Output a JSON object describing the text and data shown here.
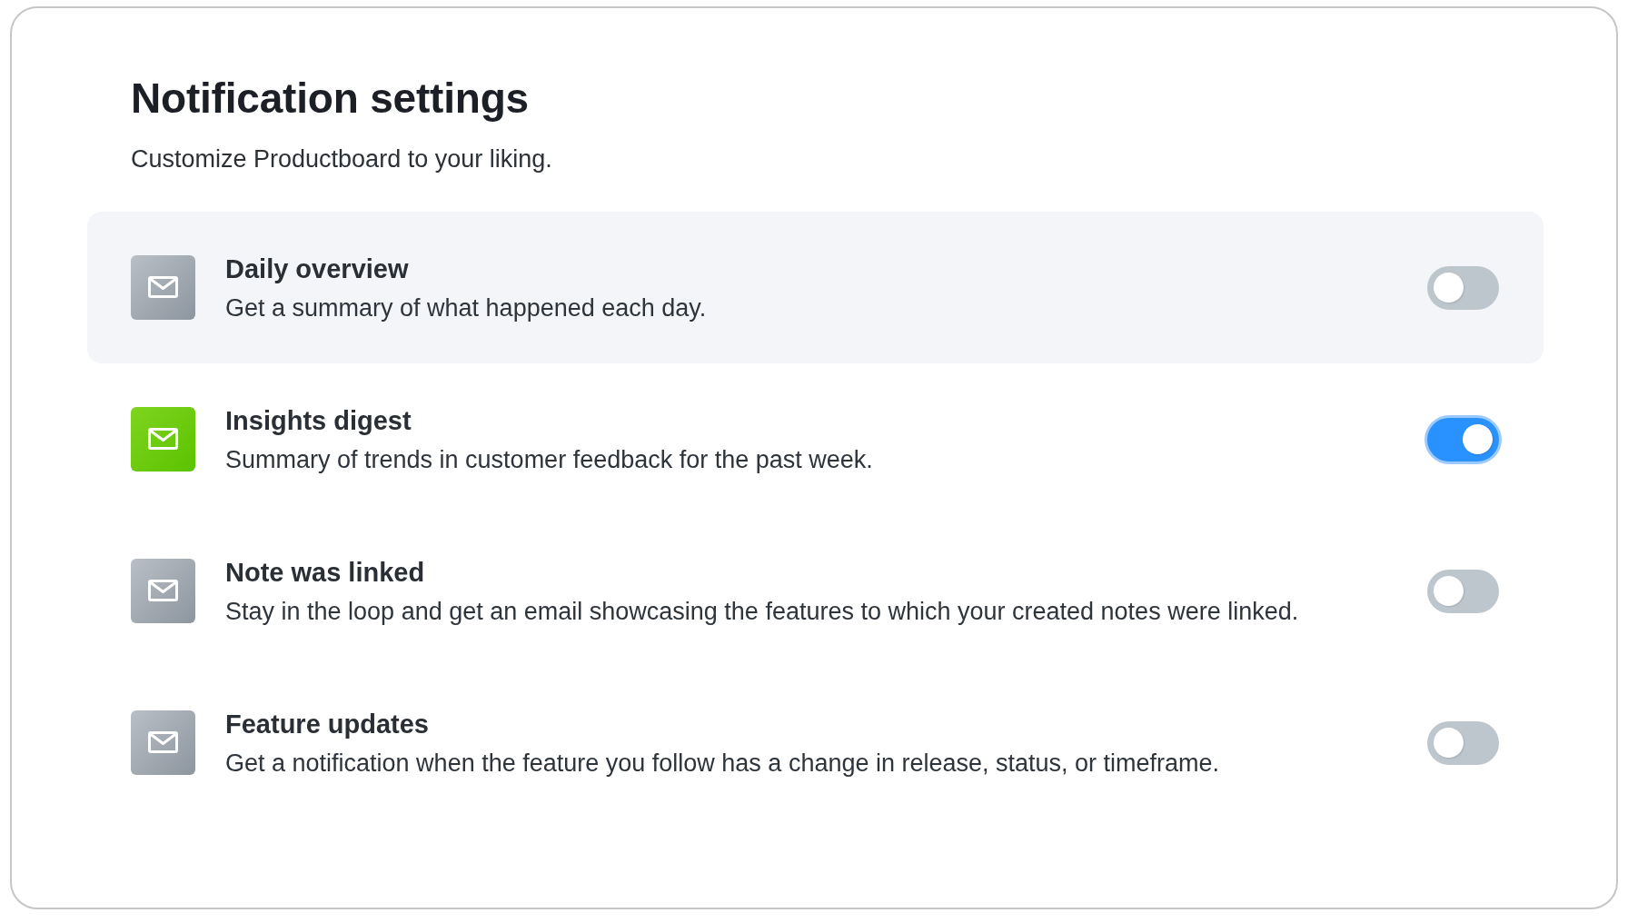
{
  "page": {
    "title": "Notification settings",
    "subtitle": "Customize Productboard to your liking."
  },
  "notifications": [
    {
      "title": "Daily overview",
      "description": "Get a summary of what happened each day.",
      "enabled": false,
      "highlighted": true
    },
    {
      "title": "Insights digest",
      "description": "Summary of trends in customer feedback for the past week.",
      "enabled": true,
      "highlighted": false
    },
    {
      "title": "Note was linked",
      "description": "Stay in the loop and get an email showcasing the features to which your created notes were linked.",
      "enabled": false,
      "highlighted": false
    },
    {
      "title": "Feature updates",
      "description": "Get a notification when the feature you follow has a change in release, status, or timeframe.",
      "enabled": false,
      "highlighted": false
    }
  ]
}
